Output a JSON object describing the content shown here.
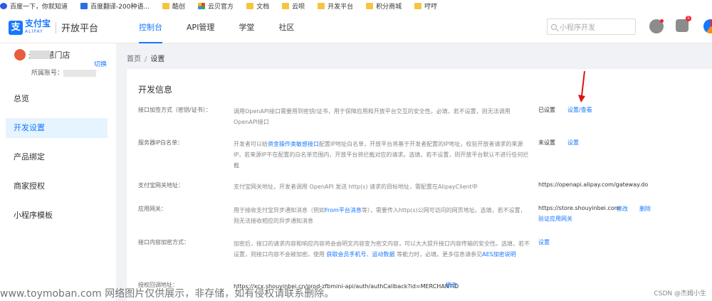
{
  "bookmarks": [
    "百度一下，你就知道",
    "百度翻译-200种语...",
    "酷创",
    "云贝官方",
    "文档",
    "云呗",
    "开发平台",
    "积分商城",
    "哼哼"
  ],
  "header": {
    "logo_mark": "支",
    "logo_brand": "支付宝",
    "logo_sub": "ALIPAY",
    "platform": "开放平台",
    "tabs": [
      "控制台",
      "API管理",
      "学堂",
      "社区"
    ],
    "search_placeholder": "小程序开发",
    "msg_badge": "5"
  },
  "sidebar": {
    "merchant_name": "光 智慧门店",
    "account_label": "所属账号：",
    "switch_label": "切换",
    "menu": [
      "总览",
      "开发设置",
      "产品绑定",
      "商家授权",
      "小程序模板"
    ]
  },
  "breadcrumb": {
    "home": "首页",
    "current": "设置"
  },
  "panel": {
    "title": "开发信息",
    "rows": [
      {
        "label": "接口加签方式（密钥/证书）：",
        "desc": "调用OpenAPI接口需要用到密钥/证书，用于保障应用和开放平台交互的安全性。必填，若不设置，则无法调用OpenAPI接口",
        "status": "已设置",
        "action": "设置/查看"
      },
      {
        "label": "服务器IP白名单：",
        "desc_pre": "开发者可以给",
        "desc_link": "资金操作类敏感接口",
        "desc_post": "配置IP地址白名单，开放平台将基于开发者配置的IP地址，校验开放者请求的来源IP，若来源IP不在配置的白名单范围内，开放平台将拦截对应的请求。选填，若不设置，则开放平台默认不进行任何拦截",
        "status": "未设置",
        "action": "设置"
      },
      {
        "label": "支付宝网关地址：",
        "desc": "支付宝网关地址，开发者调用 OpenAPI 发送 http(s) 请求的目标地址，需配置在AlipayClient中",
        "status": "https://openapi.alipay.com/gateway.do"
      },
      {
        "label": "应用网关：",
        "desc_pre": "用于接收支付宝异步通知消息（例如",
        "desc_link": "From平台消息",
        "desc_post": "等），需要传入http(s)公网可访问的网页地址。选填，若不设置，则无法接收相应的异步通知消息",
        "status": "https://store.shouyinbei.com",
        "action_edit": "修改",
        "action_delete": "删除",
        "action_verify": "验证应用网关"
      },
      {
        "label": "接口内容加密方式：",
        "desc_pre": "加密后，接口的请求内容和响应内容将会由明文内容变为密文内容，可以大大提升接口内容传输的安全性。选填，若不设置，则接口内容不会被加密。使用 ",
        "desc_link1": "获取会员手机号",
        "desc_mid": "、",
        "desc_link2": "运动数据",
        "desc_post": " 等能力时，必填。更多信息请参见",
        "desc_link3": "AES加密说明",
        "action": "设置"
      },
      {
        "label": "授权回调地址：",
        "value": "https://xcx.shouyinbei.cn/prod-zfbmini-api/auth/authCallback?id=MERCHANTID",
        "action": "修改"
      }
    ]
  },
  "watermark": "www.toymoban.com 网络图片仅供展示，非存储，如有侵权请联系删除。",
  "csdn": "CSDN @杰姆小生"
}
